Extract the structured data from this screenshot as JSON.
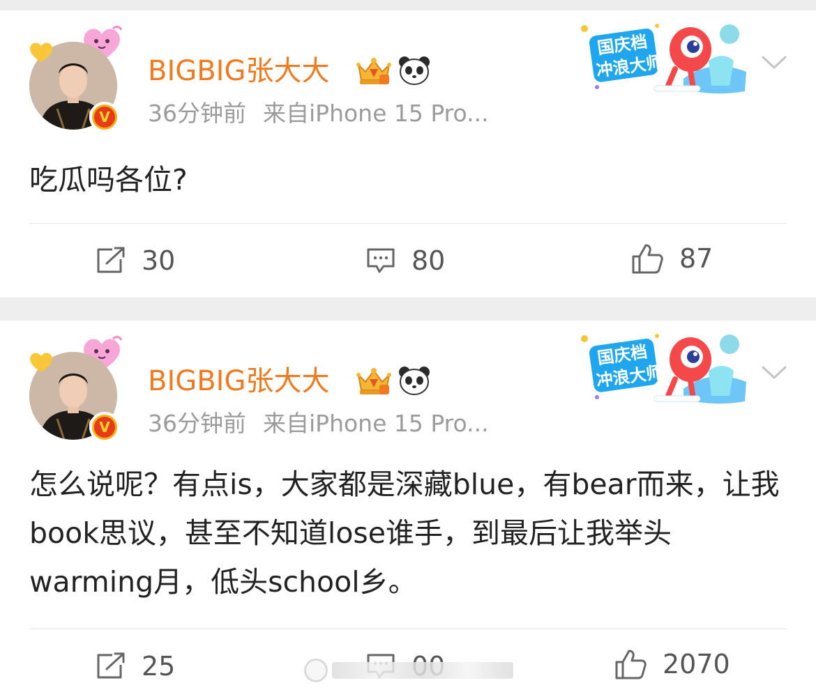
{
  "posts": [
    {
      "author": "BIGBIG张大大",
      "verified_badge": "V",
      "time": "36分钟前",
      "source": "来自iPhone 15 Pro...",
      "sticker_text": [
        "国庆档",
        "冲浪大师"
      ],
      "text": "吃瓜吗各位?",
      "actions": {
        "repost": "30",
        "comment": "80",
        "like": "87"
      }
    },
    {
      "author": "BIGBIG张大大",
      "verified_badge": "V",
      "time": "36分钟前",
      "source": "来自iPhone 15 Pro...",
      "sticker_text": [
        "国庆档",
        "冲浪大师"
      ],
      "text": "怎么说呢？有点is，大家都是深藏blue，有bear而来，让我book思议，甚至不知道lose谁手，到最后让我举头warming月，低头school乡。",
      "actions": {
        "repost": "25",
        "comment": "00",
        "like": "2070"
      }
    }
  ],
  "icons": {
    "repost": "repost-icon",
    "comment": "comment-icon",
    "like": "thumbs-up-icon",
    "more": "chevron-down-icon",
    "crown": "crown-badge-icon",
    "panda": "panda-icon"
  },
  "colors": {
    "author_name": "#f07a20",
    "meta": "#9b9b9b",
    "text": "#222222",
    "background": "#eeeeee",
    "card": "#ffffff"
  }
}
